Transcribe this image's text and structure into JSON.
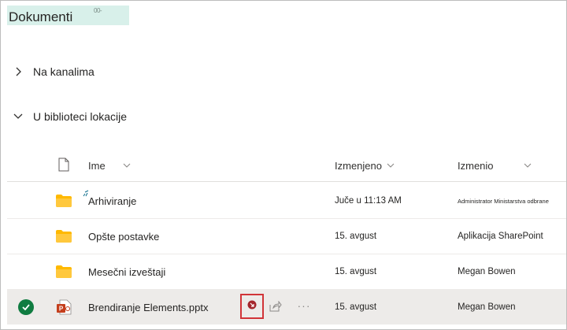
{
  "page": {
    "title": "Dokumenti",
    "title_badge": "00-"
  },
  "sections": [
    {
      "label": "Na kanalima",
      "expanded": false,
      "icon": "chevron-right-icon"
    },
    {
      "label": "U biblioteci lokacije",
      "expanded": true,
      "icon": "chevron-down-icon"
    }
  ],
  "table": {
    "columns": {
      "type_icon": "document-icon",
      "name": "Ime",
      "modified": "Izmenjeno",
      "modified_by": "Izmenio"
    },
    "rows": [
      {
        "type": "folder",
        "icon": "folder-icon",
        "name": "Arhiviranje",
        "modified": "Juče u 11:13 AM",
        "modified_by": "Administrator Ministarstva odbrane",
        "selected": false
      },
      {
        "type": "folder",
        "icon": "folder-icon",
        "name": "Opšte postavke",
        "modified": "15. avgust",
        "modified_by": "Aplikacija SharePoint",
        "selected": false
      },
      {
        "type": "folder",
        "icon": "folder-icon",
        "name": "Mesečni izveštaji",
        "modified": "15. avgust",
        "modified_by": "Megan Bowen",
        "selected": false
      },
      {
        "type": "pptx",
        "icon": "powerpoint-icon",
        "name": "Brendiranje Elements.pptx",
        "modified": "15. avgust",
        "modified_by": "Megan Bowen",
        "selected": true,
        "more_label": "···"
      }
    ]
  },
  "colors": {
    "title_highlight": "#d8f0ea",
    "folder": "#ffb900",
    "selected_row": "#edebe9",
    "check": "#107c41",
    "highlight_box": "#d13438",
    "powerpoint": "#c43e1c"
  }
}
